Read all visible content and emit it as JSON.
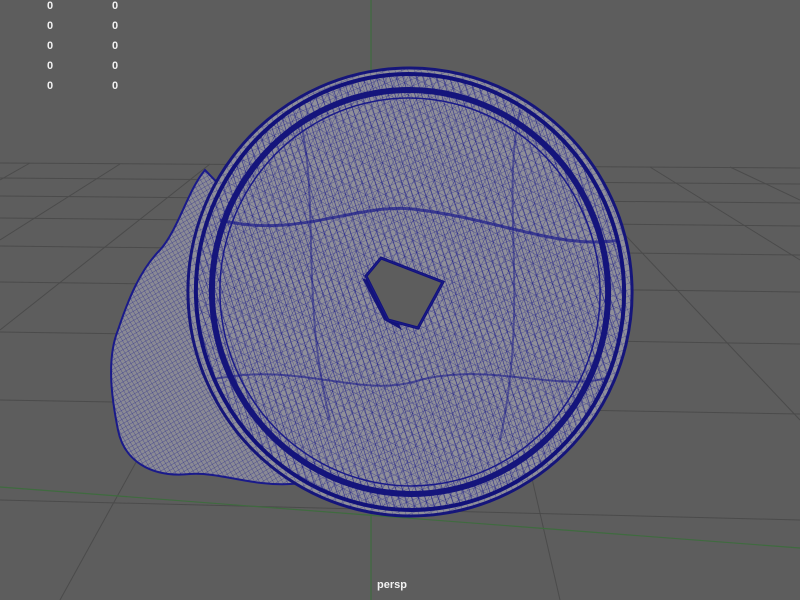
{
  "heads_up_display": {
    "rows": [
      {
        "col1": "0",
        "col2": "0"
      },
      {
        "col1": "0",
        "col2": "0"
      },
      {
        "col1": "0",
        "col2": "0"
      },
      {
        "col1": "0",
        "col2": "0"
      },
      {
        "col1": "0",
        "col2": "0"
      }
    ]
  },
  "viewport": {
    "camera_name": "persp"
  },
  "colors": {
    "viewport_background": "#5d5d5d",
    "grid_line": "#4a4a4a",
    "grid_axis_z": "#3f6b3f",
    "wireframe": "#1a1a8a",
    "surface_shade": "#8f8f99",
    "hole": "#5d5d5d",
    "hud_text": "#f2f2f2"
  },
  "scene": {
    "object": "coin-wireframe-mesh",
    "display_mode": "wireframe-on-shaded"
  }
}
